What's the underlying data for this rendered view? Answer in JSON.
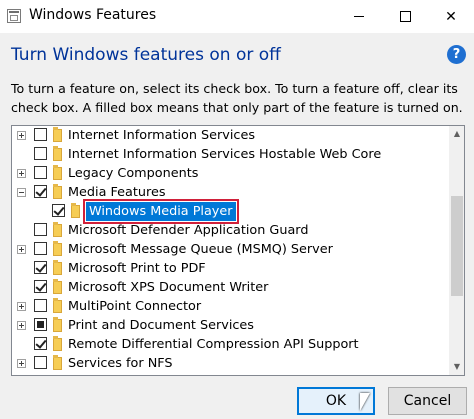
{
  "window": {
    "title": "Windows Features",
    "minimize_icon": "minimize-icon",
    "maximize_icon": "maximize-icon",
    "close_glyph": "✕"
  },
  "header": {
    "heading": "Turn Windows features on or off",
    "help_glyph": "?",
    "description": "To turn a feature on, select its check box. To turn a feature off, clear its check box. A filled box means that only part of the feature is turned on."
  },
  "features": [
    {
      "label": "Internet Information Services",
      "expander": "plus",
      "state": "unchecked",
      "indent": 0
    },
    {
      "label": "Internet Information Services Hostable Web Core",
      "expander": "none",
      "state": "unchecked",
      "indent": 0
    },
    {
      "label": "Legacy Components",
      "expander": "plus",
      "state": "unchecked",
      "indent": 0
    },
    {
      "label": "Media Features",
      "expander": "minus",
      "state": "checked",
      "indent": 0
    },
    {
      "label": "Windows Media Player",
      "expander": "none",
      "state": "checked",
      "indent": 1,
      "selected": true
    },
    {
      "label": "Microsoft Defender Application Guard",
      "expander": "none",
      "state": "unchecked",
      "indent": 0
    },
    {
      "label": "Microsoft Message Queue (MSMQ) Server",
      "expander": "plus",
      "state": "unchecked",
      "indent": 0
    },
    {
      "label": "Microsoft Print to PDF",
      "expander": "none",
      "state": "checked",
      "indent": 0
    },
    {
      "label": "Microsoft XPS Document Writer",
      "expander": "none",
      "state": "checked",
      "indent": 0
    },
    {
      "label": "MultiPoint Connector",
      "expander": "plus",
      "state": "unchecked",
      "indent": 0
    },
    {
      "label": "Print and Document Services",
      "expander": "plus",
      "state": "partial",
      "indent": 0
    },
    {
      "label": "Remote Differential Compression API Support",
      "expander": "none",
      "state": "checked",
      "indent": 0
    },
    {
      "label": "Services for NFS",
      "expander": "plus",
      "state": "unchecked",
      "indent": 0
    }
  ],
  "footer": {
    "ok_label": "OK",
    "cancel_label": "Cancel"
  },
  "colors": {
    "heading": "#003399",
    "selection": "#0078d7",
    "highlight_outline": "#d0203a"
  }
}
